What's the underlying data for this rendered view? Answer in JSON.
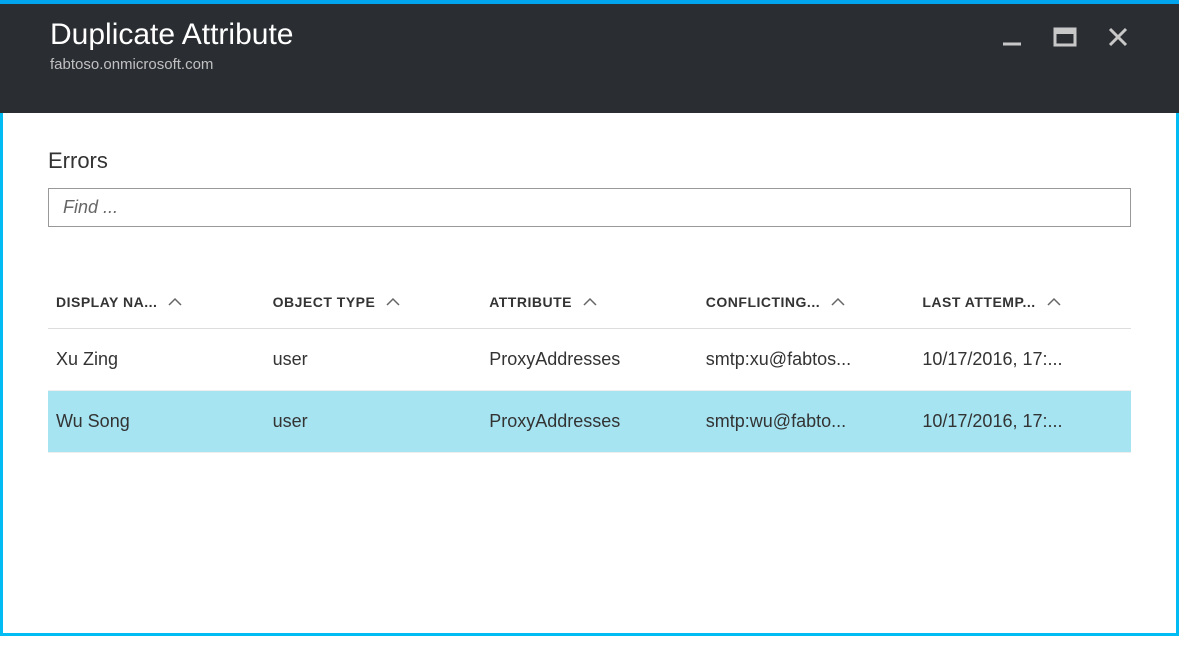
{
  "header": {
    "title": "Duplicate Attribute",
    "subtitle": "fabtoso.onmicrosoft.com"
  },
  "section": {
    "title": "Errors"
  },
  "search": {
    "placeholder": "Find ..."
  },
  "table": {
    "columns": [
      {
        "label": "DISPLAY NA..."
      },
      {
        "label": "OBJECT TYPE"
      },
      {
        "label": "ATTRIBUTE"
      },
      {
        "label": "CONFLICTING..."
      },
      {
        "label": "LAST ATTEMP..."
      }
    ],
    "rows": [
      {
        "display_name": "Xu Zing",
        "object_type": "user",
        "attribute": "ProxyAddresses",
        "conflicting": "smtp:xu@fabtos...",
        "last_attempt": "10/17/2016, 17:...",
        "selected": false
      },
      {
        "display_name": "Wu Song",
        "object_type": "user",
        "attribute": "ProxyAddresses",
        "conflicting": "smtp:wu@fabto...",
        "last_attempt": "10/17/2016, 17:...",
        "selected": true
      }
    ]
  }
}
